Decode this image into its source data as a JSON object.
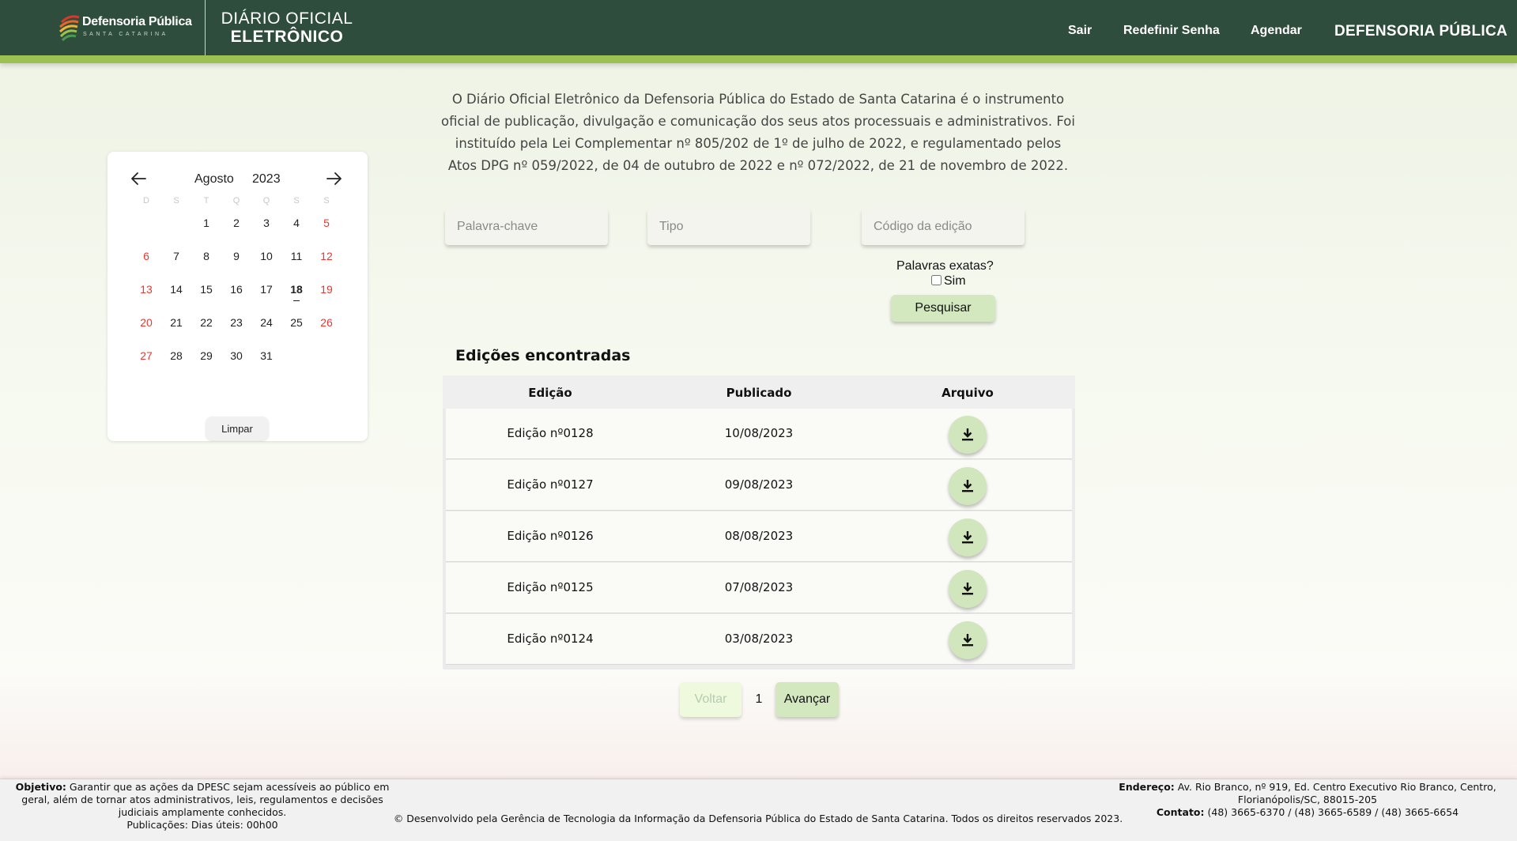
{
  "header": {
    "logo_title": "Defensoria Pública",
    "logo_subtitle": "SANTA CATARINA",
    "site_title_line1": "DIÁRIO OFICIAL",
    "site_title_line2": "ELETRÔNICO",
    "nav": [
      "Sair",
      "Redefinir Senha",
      "Agendar"
    ],
    "brand": "DEFENSORIA PÚBLICA",
    "colors": {
      "header_bg": "#2f4d3c",
      "accent_bar": "#9cc152"
    }
  },
  "calendar": {
    "month": "Agosto",
    "year": "2023",
    "weekdays": [
      "D",
      "S",
      "T",
      "Q",
      "Q",
      "S",
      "S"
    ],
    "days": [
      "1",
      "2",
      "3",
      "4",
      "5",
      "6",
      "7",
      "8",
      "9",
      "10",
      "11",
      "12",
      "13",
      "14",
      "15",
      "16",
      "17",
      "18",
      "19",
      "20",
      "21",
      "22",
      "23",
      "24",
      "25",
      "26",
      "27",
      "28",
      "29",
      "30",
      "31"
    ],
    "today": "18",
    "clear_label": "Limpar",
    "icons": {
      "prev": "arrow-left-icon",
      "next": "arrow-right-icon"
    },
    "weekend_color": "#e53935"
  },
  "intro": "O Diário Oficial Eletrônico da Defensoria Pública do Estado de Santa Catarina é o instrumento oficial de publicação, divulgação e comunicação dos seus atos processuais e administrativos. Foi instituído pela Lei Complementar nº 805/202 de 1º de julho de 2022, e regulamentado pelos Atos DPG nº 059/2022, de 04 de outubro de 2022 e nº 072/2022, de 21 de novembro de 2022.",
  "search": {
    "keyword_placeholder": "Palavra-chave",
    "type_placeholder": "Tipo",
    "code_placeholder": "Código da edição",
    "exact_label": "Palavras exatas?",
    "exact_option": "Sim",
    "exact_checked": false,
    "submit_label": "Pesquisar"
  },
  "results": {
    "title": "Edições encontradas",
    "columns": [
      "Edição",
      "Publicado",
      "Arquivo"
    ],
    "rows": [
      {
        "edition": "Edição nº0128",
        "published": "10/08/2023"
      },
      {
        "edition": "Edição nº0127",
        "published": "09/08/2023"
      },
      {
        "edition": "Edição nº0126",
        "published": "08/08/2023"
      },
      {
        "edition": "Edição nº0125",
        "published": "07/08/2023"
      },
      {
        "edition": "Edição nº0124",
        "published": "03/08/2023"
      }
    ],
    "download_icon": "download-icon"
  },
  "pagination": {
    "prev": "Voltar",
    "page": "1",
    "next": "Avançar"
  },
  "footer": {
    "objective_label": "Objetivo:",
    "objective_text": "Garantir que as ações da DPESC sejam acessíveis ao público em geral, além de tornar atos administrativos, leis, regulamentos e decisões judiciais amplamente conhecidos.",
    "publications": "Publicações: Dias úteis: 00h00",
    "copyright": "© Desenvolvido pela Gerência de Tecnologia da Informação da Defensoria Pública do Estado de Santa Catarina. Todos os direitos reservados 2023.",
    "address_label": "Endereço:",
    "address_text": "Av. Rio Branco, nº 919, Ed. Centro Executivo Rio Branco, Centro, Florianópolis/SC, 88015-205",
    "contact_label": "Contato:",
    "contact_text": "(48) 3665-6370 / (48) 3665-6589 / (48) 3665-6654"
  }
}
